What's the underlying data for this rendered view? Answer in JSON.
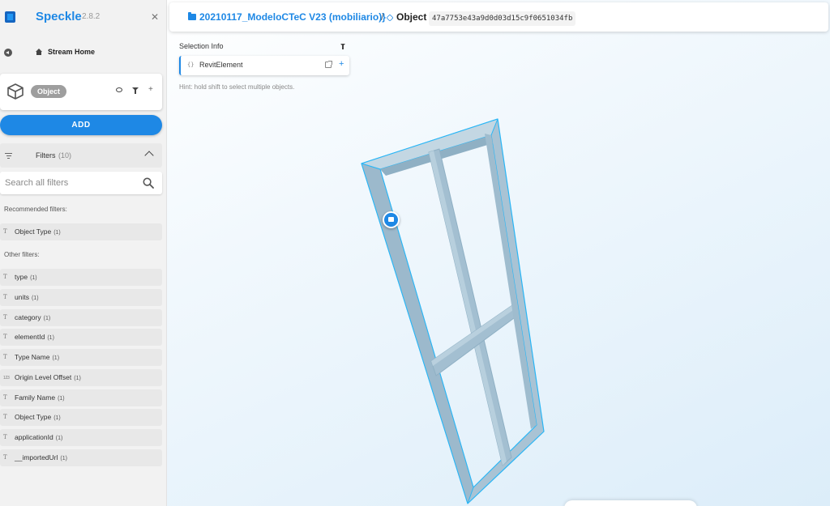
{
  "app": {
    "name": "Speckle",
    "version": "2.8.2",
    "close_icon": "close-icon"
  },
  "nav": {
    "stream_home": "Stream Home",
    "back_icon": "back-arrow-icon",
    "home_icon": "home-icon"
  },
  "object_card": {
    "chip": "Object",
    "icons": [
      "cube-icon",
      "eye-icon",
      "filter-icon",
      "plus-icon"
    ]
  },
  "add_button": "ADD",
  "filters": {
    "title": "Filters",
    "count": "(10)",
    "search_placeholder": "Search all filters",
    "recommended_label": "Recommended filters:",
    "recommended": [
      {
        "icon": "T",
        "label": "Object Type",
        "count": "(1)"
      }
    ],
    "other_label": "Other filters:",
    "other": [
      {
        "icon": "T",
        "label": "type",
        "count": "(1)"
      },
      {
        "icon": "T",
        "label": "units",
        "count": "(1)"
      },
      {
        "icon": "T",
        "label": "category",
        "count": "(1)"
      },
      {
        "icon": "T",
        "label": "elementId",
        "count": "(1)"
      },
      {
        "icon": "T",
        "label": "Type Name",
        "count": "(1)"
      },
      {
        "icon": "123",
        "label": "Origin Level Offset",
        "count": "(1)"
      },
      {
        "icon": "T",
        "label": "Family Name",
        "count": "(1)"
      },
      {
        "icon": "T",
        "label": "Object Type",
        "count": "(1)"
      },
      {
        "icon": "T",
        "label": "applicationId",
        "count": "(1)"
      },
      {
        "icon": "T",
        "label": "__importedUrl",
        "count": "(1)"
      }
    ]
  },
  "breadcrumb": {
    "stream": "20210117_ModeloCTeC V23 (mobiliario)}",
    "separator": "/",
    "object": "Object",
    "object_id": "47a7753e43a9d0d03d15c9f0651034fb"
  },
  "selection": {
    "title": "Selection Info",
    "braces": "{}",
    "item": "RevitElement",
    "hint": "Hint: hold shift to select multiple objects."
  },
  "colors": {
    "accent": "#1e88e5",
    "model_fill": "#a9c4d6",
    "selection_outline": "#29b6f6"
  }
}
